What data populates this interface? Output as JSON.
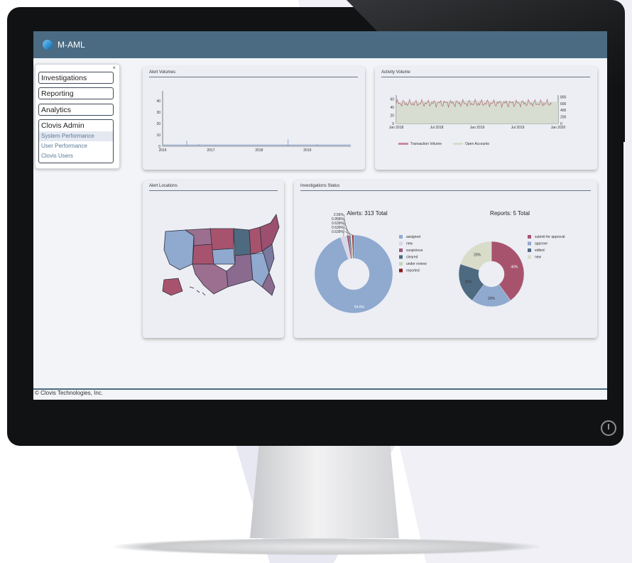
{
  "app": {
    "title": "M-AML"
  },
  "sidebar": {
    "close": "×",
    "items": [
      {
        "label": "Investigations"
      },
      {
        "label": "Reporting"
      },
      {
        "label": "Analytics"
      }
    ],
    "admin": {
      "label": "Clovis Admin",
      "subitems": [
        {
          "label": "System Performance",
          "active": true
        },
        {
          "label": "User Performance"
        },
        {
          "label": "Clovis Users"
        }
      ]
    }
  },
  "panels": {
    "alert_volumes": {
      "title": "Alert Volumes"
    },
    "activity_volume": {
      "title": "Activity Volume"
    },
    "alert_locations": {
      "title": "Alert Locations"
    },
    "investigations_status": {
      "title": "Investigations Status"
    }
  },
  "footer": {
    "text": "© Clovis Technologies, Inc."
  },
  "colors": {
    "header": "#4a6b82",
    "assigned": "#8fa9cf",
    "new": "#d7d6e6",
    "suspicious": "#9c5a78",
    "cleared": "#4e6a80",
    "under_review": "#c9d4bb",
    "reported": "#8b1a1a",
    "submit": "#a8536e",
    "approve": "#8fa9cf",
    "edited": "#4e6a80",
    "new_report": "#d8dcc9"
  },
  "chart_data": [
    {
      "type": "bar",
      "title": "Alert Volumes",
      "x_ticks": [
        "2016",
        "2017",
        "2018",
        "2019"
      ],
      "y_ticks": [
        "0",
        "10",
        "20",
        "30",
        "40"
      ],
      "ylim": [
        0,
        45
      ],
      "spikes": [
        {
          "x": "2016.5",
          "y": 5
        },
        {
          "x": "2016.75",
          "y": 2
        },
        {
          "x": "2017.1",
          "y": 1
        },
        {
          "x": "2018.6",
          "y": 6
        },
        {
          "x": "2019.2",
          "y": 2
        }
      ],
      "baseline": 1
    },
    {
      "type": "line",
      "title": "Activity Volume",
      "x_ticks": [
        "Jan 2018",
        "Jul 2018",
        "Jan 2019",
        "Jul 2019",
        "Jan 2020"
      ],
      "y_left_ticks": [
        "0",
        "20",
        "40",
        "60"
      ],
      "y_right_ticks": [
        "0",
        "200",
        "400",
        "600",
        "800"
      ],
      "series": [
        {
          "name": "Transaction Volume",
          "approx_range": [
            40,
            60
          ]
        },
        {
          "name": "Open Accounts",
          "approx_level": 650
        }
      ]
    },
    {
      "type": "pie",
      "title": "Alerts: 313 Total",
      "slices": [
        {
          "label": "assigned",
          "value": 94.6,
          "text": "94.6%"
        },
        {
          "label": "new",
          "value": 2.56,
          "text": "2.56%"
        },
        {
          "label": "suspicious",
          "value": 0.958,
          "text": "0.958%"
        },
        {
          "label": "cleared",
          "value": 0.639,
          "text": "0.639%"
        },
        {
          "label": "under review",
          "value": 0.639,
          "text": "0.639%"
        },
        {
          "label": "reported",
          "value": 0.639,
          "text": "0.639%"
        }
      ]
    },
    {
      "type": "pie",
      "title": "Reports: 5 Total",
      "slices": [
        {
          "label": "submit for approval",
          "value": 40,
          "text": "40%"
        },
        {
          "label": "approve",
          "value": 20,
          "text": "20%"
        },
        {
          "label": "edited",
          "value": 20,
          "text": "20%"
        },
        {
          "label": "new",
          "value": 20,
          "text": "20%"
        }
      ]
    }
  ]
}
